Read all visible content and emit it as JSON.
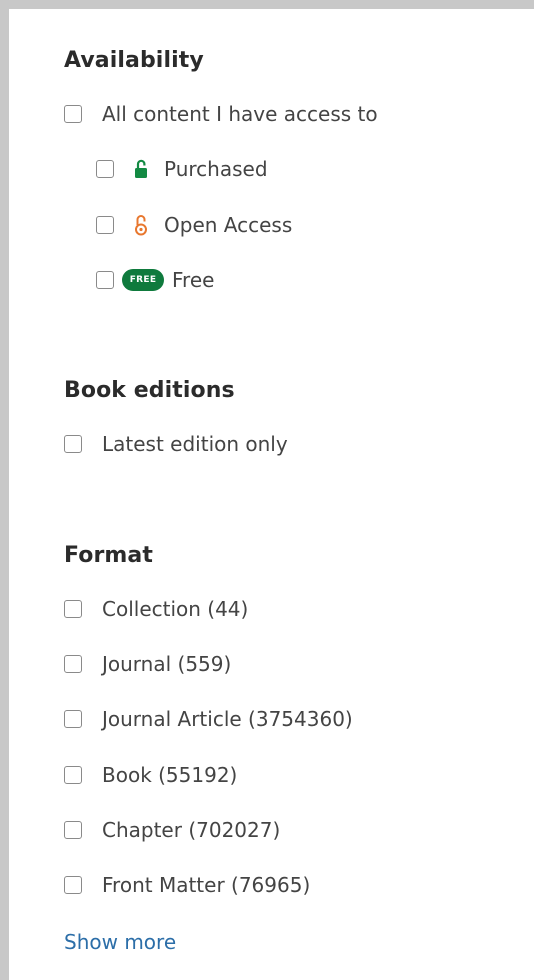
{
  "availability": {
    "heading": "Availability",
    "all_content_label": "All content I have access to",
    "options": [
      {
        "label": "Purchased",
        "icon": "unlocked-padlock-icon",
        "color": "#138a43"
      },
      {
        "label": "Open Access",
        "icon": "open-access-icon",
        "color": "#e8772e"
      },
      {
        "label": "Free",
        "icon": "free-badge-icon",
        "badge_text": "FREE",
        "color": "#0f7a3d"
      }
    ]
  },
  "book_editions": {
    "heading": "Book editions",
    "latest_label": "Latest edition only"
  },
  "format": {
    "heading": "Format",
    "items": [
      {
        "label": "Collection (44)"
      },
      {
        "label": "Journal (559)"
      },
      {
        "label": "Journal Article (3754360)"
      },
      {
        "label": "Book (55192)"
      },
      {
        "label": "Chapter (702027)"
      },
      {
        "label": "Front Matter (76965)"
      }
    ],
    "show_more": "Show more"
  },
  "colors": {
    "link": "#2c6ea8",
    "heading": "#2b2b2b",
    "text": "#444444",
    "checkbox_border": "#8a8a8a"
  }
}
